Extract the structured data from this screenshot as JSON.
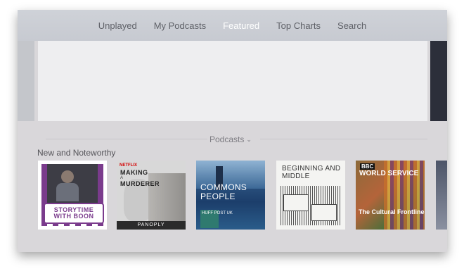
{
  "nav": {
    "tabs": [
      {
        "label": "Unplayed"
      },
      {
        "label": "My Podcasts"
      },
      {
        "label": "Featured",
        "active": true
      },
      {
        "label": "Top Charts"
      },
      {
        "label": "Search"
      }
    ]
  },
  "section": {
    "label": "Podcasts",
    "chevron": "chevron-down-icon"
  },
  "row": {
    "title": "New and Noteworthy",
    "items": [
      {
        "title": "STORYTIME WITH BOON"
      },
      {
        "brand": "NETFLIX",
        "title_top": "MAKING",
        "title_mid": "A",
        "title_bottom": "MURDERER",
        "publisher": "PANOPLY"
      },
      {
        "title": "COMMONS PEOPLE",
        "badge": "HUFF POST UK"
      },
      {
        "title": "BEGINNING AND MIDDLE"
      },
      {
        "brand": "BBC",
        "title_top": "WORLD SERVICE",
        "title": "The Cultural Frontline"
      },
      {
        "title": ""
      }
    ]
  },
  "colors": {
    "active_tab": "#ffffff",
    "inactive_tab": "#5f6168",
    "screen_bg": "#d9d7da"
  }
}
